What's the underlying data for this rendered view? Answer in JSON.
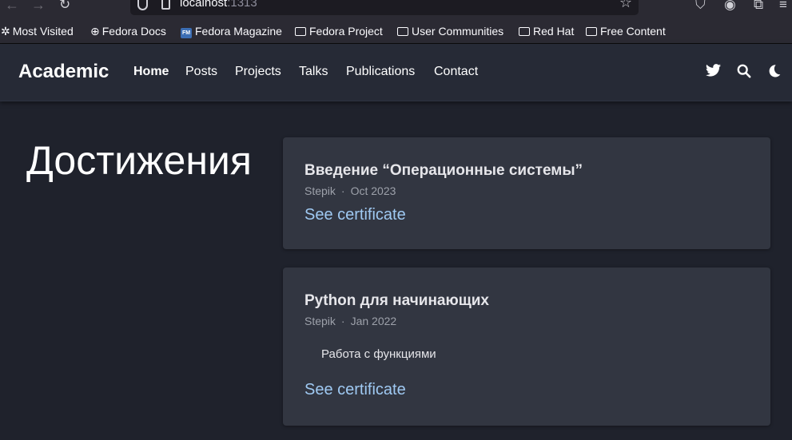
{
  "browser": {
    "url_host": "localhost",
    "url_port": ":1313",
    "bookmarks": [
      {
        "label": "Most Visited",
        "icon": "gear-icon"
      },
      {
        "label": "Fedora Docs",
        "icon": "globe-icon"
      },
      {
        "label": "Fedora Magazine",
        "icon": "fedora-magazine-icon"
      },
      {
        "label": "Fedora Project",
        "icon": "folder-icon"
      },
      {
        "label": "User Communities",
        "icon": "folder-icon"
      },
      {
        "label": "Red Hat",
        "icon": "folder-icon"
      },
      {
        "label": "Free Content",
        "icon": "folder-icon"
      }
    ],
    "fm_badge": "FM"
  },
  "navbar": {
    "brand": "Academic",
    "links": [
      {
        "label": "Home",
        "active": true
      },
      {
        "label": "Posts"
      },
      {
        "label": "Projects"
      },
      {
        "label": "Talks"
      },
      {
        "label": "Publications"
      },
      {
        "label": "Contact"
      }
    ]
  },
  "page": {
    "title": "Достижения"
  },
  "cards": [
    {
      "title": "Введение “Операционные системы”",
      "org": "Stepik",
      "date": "Oct 2023",
      "link": "See certificate"
    },
    {
      "title": "Python для начинающих",
      "org": "Stepik",
      "date": "Jan 2022",
      "description": "Работа с функциями",
      "link": "See certificate"
    }
  ],
  "colors": {
    "background": "#1f222c",
    "navbar": "#262a36",
    "card": "#323641",
    "link": "#9fc9f2"
  }
}
